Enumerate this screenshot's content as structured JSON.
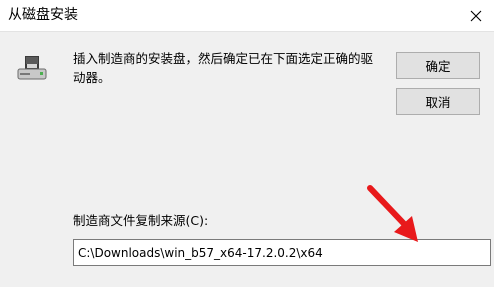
{
  "window": {
    "title": "从磁盘安装",
    "close_icon": "close-icon"
  },
  "dialog": {
    "icon": "floppy-drive-icon",
    "message": "插入制造商的安装盘，然后确定已在下面选定正确的驱动器。",
    "ok_label": "确定",
    "cancel_label": "取消"
  },
  "path": {
    "label": "制造商文件复制来源(C):",
    "value": "C:\\Downloads\\win_b57_x64-17.2.0.2\\x64"
  },
  "annotation": {
    "arrow_color": "#e8191b"
  }
}
